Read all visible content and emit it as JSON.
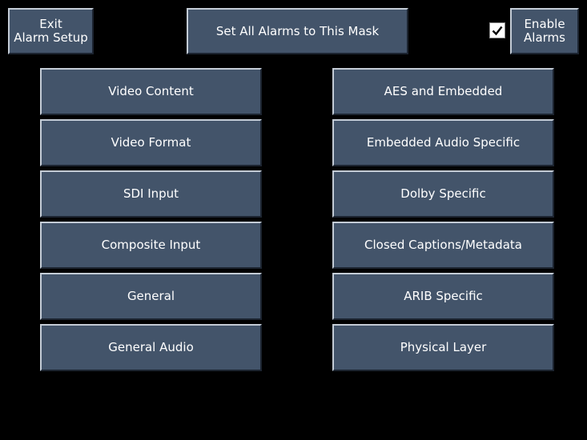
{
  "toolbar": {
    "exit_line1": "Exit",
    "exit_line2": "Alarm Setup",
    "set_all": "Set All Alarms to This Mask",
    "enable_line1": "Enable",
    "enable_line2": "Alarms",
    "enable_checked": true
  },
  "categories_left": [
    "Video Content",
    "Video Format",
    "SDI Input",
    "Composite Input",
    "General",
    "General Audio"
  ],
  "categories_right": [
    "AES and Embedded",
    "Embedded Audio Specific",
    "Dolby Specific",
    "Closed Captions/Metadata",
    "ARIB Specific",
    "Physical Layer"
  ],
  "colors": {
    "background": "#000000",
    "button_face": "#43546a",
    "button_text": "#ffffff"
  }
}
